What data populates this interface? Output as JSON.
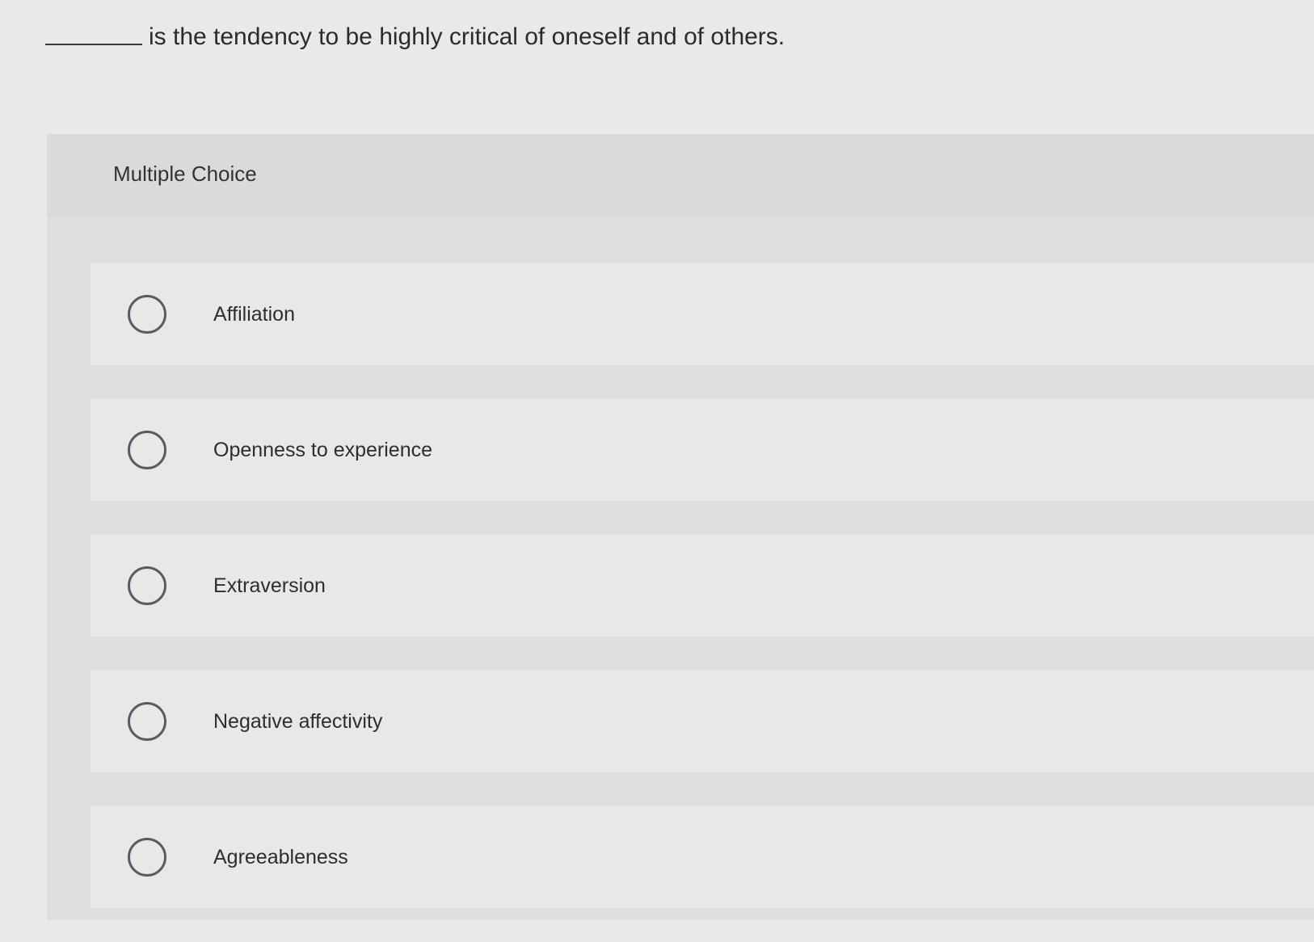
{
  "question": {
    "text": "is the tendency to be highly critical of oneself and of others."
  },
  "section": {
    "label": "Multiple Choice"
  },
  "choices": [
    {
      "label": "Affiliation"
    },
    {
      "label": "Openness to experience"
    },
    {
      "label": "Extraversion"
    },
    {
      "label": "Negative affectivity"
    },
    {
      "label": "Agreeableness"
    }
  ],
  "colors": {
    "background": "#e9e9e8",
    "panel": "#dedede",
    "choice_background": "#e8e8e7",
    "radio_border": "#5b5b63",
    "text": "#2b2b2b"
  }
}
